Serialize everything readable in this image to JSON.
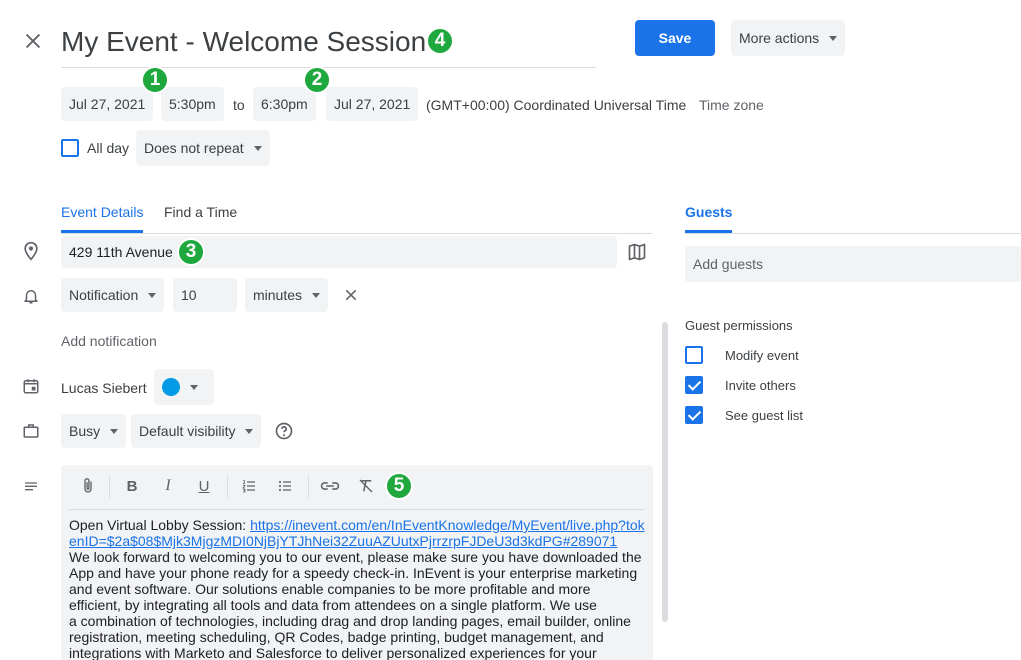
{
  "header": {
    "title": "My Event - Welcome Session",
    "save_label": "Save",
    "more_actions_label": "More actions"
  },
  "datetime": {
    "start_date": "Jul 27, 2021",
    "start_time": "5:30pm",
    "to_label": "to",
    "end_time": "6:30pm",
    "end_date": "Jul 27, 2021",
    "timezone_text": "(GMT+00:00) Coordinated Universal Time",
    "timezone_link": "Time zone",
    "all_day_label": "All day",
    "all_day_checked": false,
    "repeat_value": "Does not repeat"
  },
  "tabs": [
    {
      "label": "Event Details",
      "active": true
    },
    {
      "label": "Find a Time",
      "active": false
    }
  ],
  "guests_tab": {
    "label": "Guests"
  },
  "details": {
    "location": "429 11th Avenue",
    "notification_type": "Notification",
    "notification_value": "10",
    "notification_unit": "minutes",
    "add_notification_label": "Add notification",
    "calendar_owner": "Lucas Siebert",
    "calendar_color": "#039be5",
    "availability": "Busy",
    "visibility": "Default visibility"
  },
  "guests": {
    "add_placeholder": "Add guests",
    "permissions_title": "Guest permissions",
    "permissions": [
      {
        "label": "Modify event",
        "checked": false
      },
      {
        "label": "Invite others",
        "checked": true
      },
      {
        "label": "See guest list",
        "checked": true
      }
    ]
  },
  "description": {
    "intro": "Open Virtual Lobby Session: ",
    "link_text": "https://inevent.com/en/InEventKnowledge/MyEvent/live.php?tokenID=$2a$08$Mjk3MjgzMDI0NjBjYTJhNei32ZuuAZUutxPjrrzrpFJDeU3d3kdPG#289071",
    "body_lines": [
      "We look forward to welcoming you to our event, please make sure you have downloaded the",
      "App and have your phone ready for a speedy check-in. InEvent is your enterprise marketing",
      "and event software. Our solutions enable companies to be more profitable and more",
      "efficient, by integrating all tools and data from attendees on a single platform. We use",
      "a combination of technologies, including drag and drop landing pages, email builder, online",
      "registration, meeting scheduling, QR Codes, badge printing, budget management, and",
      "integrations with Marketo and Salesforce to deliver personalized experiences for your"
    ]
  },
  "badges": [
    "1",
    "2",
    "3",
    "4",
    "5"
  ],
  "colors": {
    "accent": "#1a73e8",
    "badge": "#1fa83d",
    "chip_bg": "#f1f3f4"
  }
}
